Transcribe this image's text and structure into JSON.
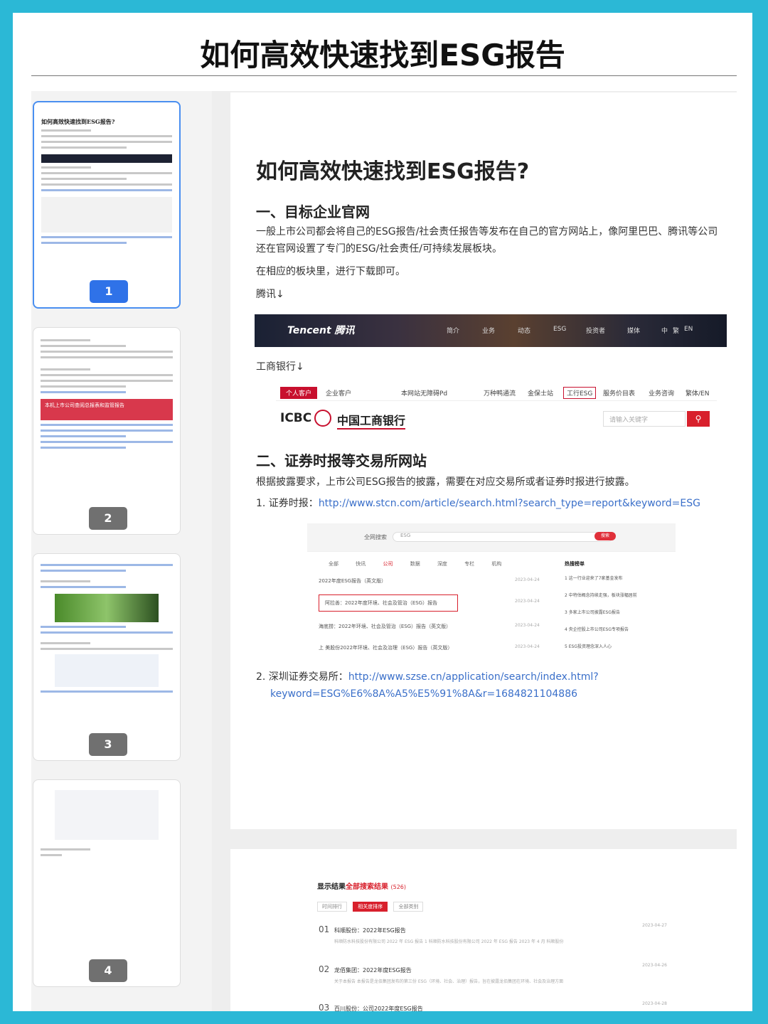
{
  "header": {
    "title": "如何高效快速找到ESG报告"
  },
  "thumbnails": [
    {
      "page": "1",
      "active": true
    },
    {
      "page": "2",
      "active": false
    },
    {
      "page": "3",
      "active": false
    },
    {
      "page": "4",
      "active": false
    }
  ],
  "thumb1": {
    "title": "如何高效快速找到ESG报告?"
  },
  "thumb2": {
    "banner": "本机上市公司查阅总报表和监管报告"
  },
  "document": {
    "title": "如何高效快速找到ESG报告?",
    "section1": {
      "heading": "一、目标企业官网",
      "paragraph": "一般上市公司都会将自己的ESG报告/社会责任报告等发布在自己的官方网站上，像阿里巴巴、腾讯等公司还在官网设置了专门的ESG/社会责任/可持续发展板块。",
      "paragraph2": "在相应的板块里，进行下载即可。",
      "tencent_label": "腾讯↓",
      "icbc_label": "工商银行↓"
    },
    "section2": {
      "heading": "二、证券时报等交易所网站",
      "paragraph": "根据披露要求，上市公司ESG报告的披露，需要在对应交易所或者证券时报进行披露。",
      "item1_label": "1.  证券时报：",
      "item1_url": "http://www.stcn.com/article/search.html?search_type=report&keyword=ESG",
      "item2_label": "2.  深圳证券交易所：",
      "item2_url_line1": "http://www.szse.cn/application/search/index.html?",
      "item2_url_line2": "keyword=ESG%E6%8A%A5%E5%91%8A&r=1684821104886"
    }
  },
  "tencent_site": {
    "logo": "Tencent 腾讯",
    "nav": [
      "简介",
      "业务",
      "动态",
      "ESG",
      "投资者",
      "媒体",
      "中",
      "繁",
      "EN"
    ]
  },
  "icbc_site": {
    "tabs": [
      "个人客户",
      "企业客户",
      "本网站无障碍Pd",
      "万种鸭通流",
      "金保士站",
      "工行ESG",
      "服务价目表",
      "业务咨询",
      "繁体/EN"
    ],
    "logo_en": "ICBC",
    "logo_cn": "中国工商银行",
    "search_placeholder": "请输入关键字",
    "search_icon": "magnifier-icon"
  },
  "stcn_site": {
    "search_label": "全网搜索",
    "search_value": "ESG",
    "search_button": "搜索",
    "categories": [
      "全部",
      "快讯",
      "公司",
      "数据",
      "深度",
      "专栏",
      "机构"
    ],
    "rows": [
      {
        "text": "2022年度ESG报告（英文版）",
        "date": "2023-04-24"
      },
      {
        "text": "阿拉善：2022年度环境、社会及管治（ESG）报告",
        "date": "2023-04-24"
      },
      {
        "text": "海底捞：2022年环境、社会及管治（ESG）报告（英文版）",
        "date": "2023-04-24"
      },
      {
        "text": "上 美股份2022年环境、社会及治理（ESG）报告（英文版）",
        "date": "2023-04-24"
      }
    ],
    "side_title": "热搜榜单",
    "side_items": [
      "1 这一行业迎来了7家基金发布",
      "2 中特估概念持续走强，板块涨幅居前",
      "3 多家上市公司披露ESG报告",
      "4 央企控股上市公司ESG专项报告",
      "5 ESG投资理念深入人心"
    ]
  },
  "szse_site": {
    "heading_prefix": "显示结果",
    "heading_highlight": "全部搜索结果",
    "count": "(526)",
    "filters": [
      "时间排行",
      "相关度排序",
      "全部类别"
    ],
    "results": [
      {
        "num": "01",
        "title": "科顺股份：2022年ESG报告",
        "date": "2023-04-27",
        "desc": "科顺防水科技股份有限公司 2022 年 ESG 报告 1 科顺防水科技股份有限公司 2022 年 ESG 报告 2023 年 4 月 科顺股份"
      },
      {
        "num": "02",
        "title": "龙佰集团：2022年度ESG报告",
        "date": "2023-04-26",
        "desc": "关于本报告 本报告是龙佰集团发布的第三份 ESG（环境、社会、治理）报告，旨在披露龙佰集团在环境、社会及治理方面"
      },
      {
        "num": "03",
        "title": "百川股份：公司2022年度ESG报告",
        "date": "2023-04-28",
        "desc": ""
      }
    ]
  },
  "colors": {
    "background": "#2bb8d6",
    "accent": "#2f72e8",
    "link": "#3a6fc9",
    "brand_red": "#d8202c"
  }
}
